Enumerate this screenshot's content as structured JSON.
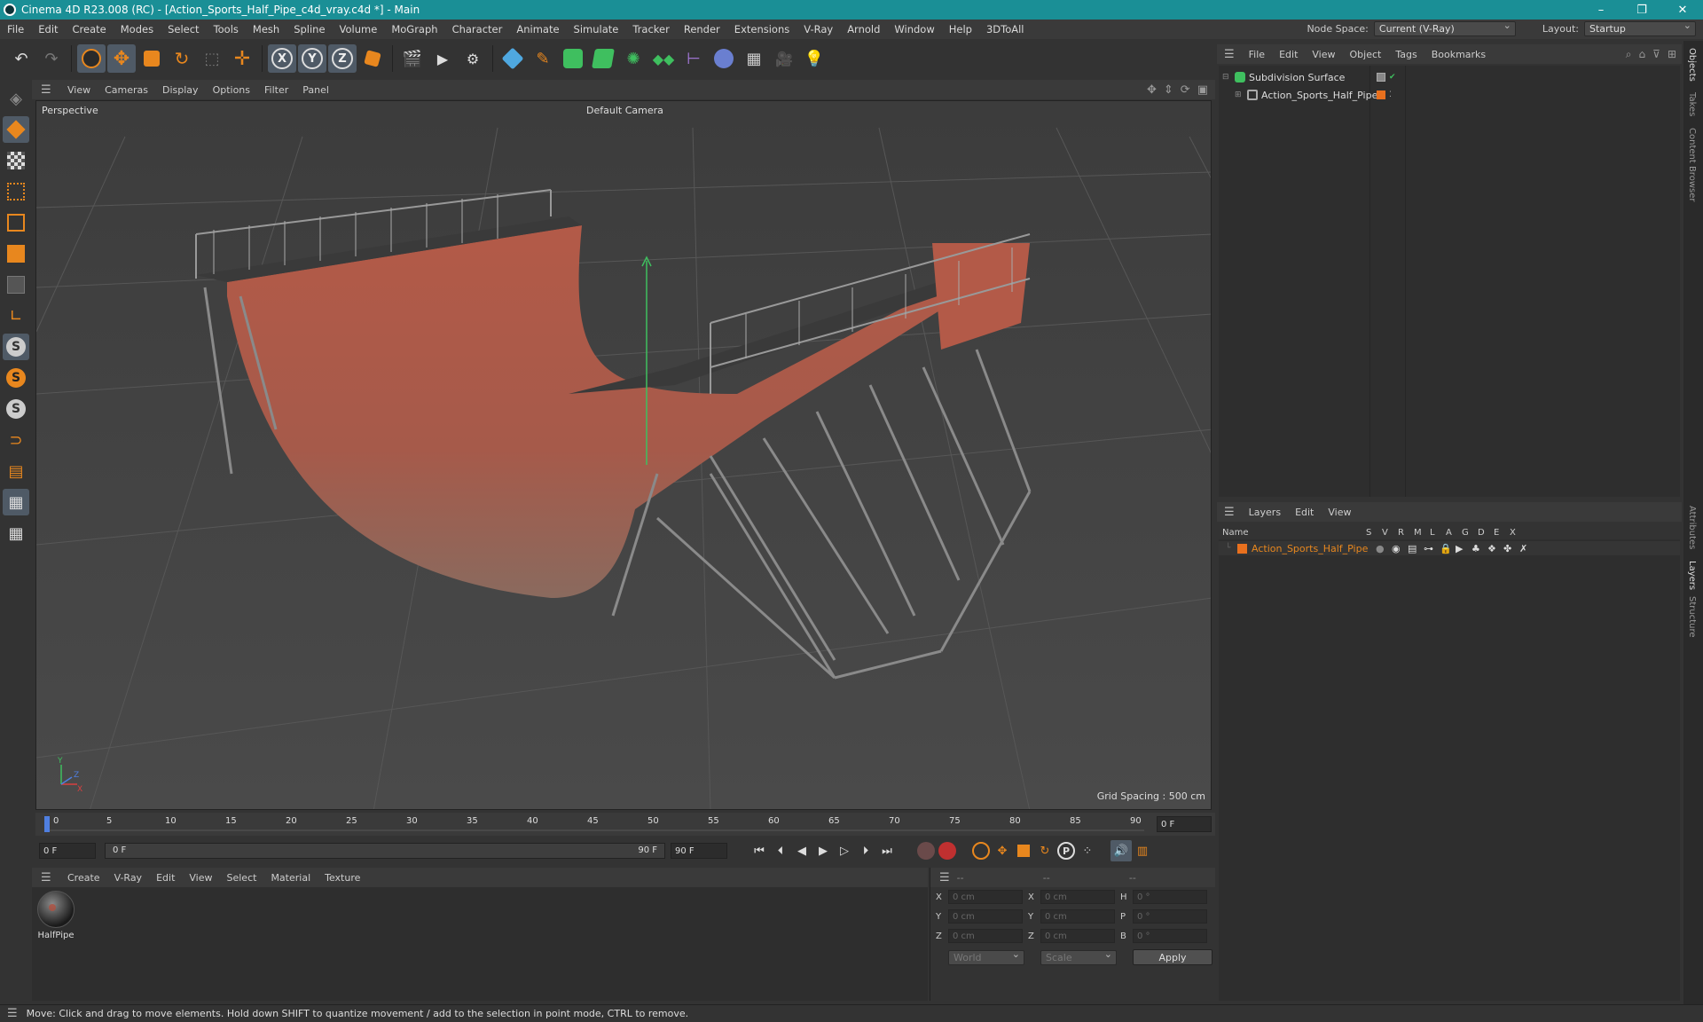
{
  "window": {
    "title": "Cinema 4D R23.008 (RC) - [Action_Sports_Half_Pipe_c4d_vray.c4d *] - Main",
    "controls": [
      "–",
      "❐",
      "✕"
    ]
  },
  "menu": {
    "items": [
      "File",
      "Edit",
      "Create",
      "Modes",
      "Select",
      "Tools",
      "Mesh",
      "Spline",
      "Volume",
      "MoGraph",
      "Character",
      "Animate",
      "Simulate",
      "Tracker",
      "Render",
      "Extensions",
      "V-Ray",
      "Arnold",
      "Window",
      "Help",
      "3DToAll"
    ],
    "node_space_label": "Node Space:",
    "node_space_value": "Current (V-Ray)",
    "layout_label": "Layout:",
    "layout_value": "Startup"
  },
  "toolbar": {
    "axes": [
      "X",
      "Y",
      "Z"
    ]
  },
  "viewport": {
    "menu": [
      "View",
      "Cameras",
      "Display",
      "Options",
      "Filter",
      "Panel"
    ],
    "name": "Perspective",
    "camera": "Default Camera",
    "grid_spacing": "Grid Spacing : 500 cm"
  },
  "timeline": {
    "ticks": [
      "0",
      "5",
      "10",
      "15",
      "20",
      "25",
      "30",
      "35",
      "40",
      "45",
      "50",
      "55",
      "60",
      "65",
      "70",
      "75",
      "80",
      "85",
      "90"
    ],
    "current_frame": "0 F"
  },
  "playbar": {
    "start_frame": "0 F",
    "range_start": "0 F",
    "range_end": "90 F",
    "end_frame": "90 F"
  },
  "material_manager": {
    "menu": [
      "Create",
      "V-Ray",
      "Edit",
      "View",
      "Select",
      "Material",
      "Texture"
    ],
    "materials": [
      {
        "name": "HalfPipe"
      }
    ]
  },
  "coordinates": {
    "headers": [
      "--",
      "--",
      "--"
    ],
    "rows": [
      {
        "a1": "X",
        "v1": "0 cm",
        "a2": "X",
        "v2": "0 cm",
        "a3": "H",
        "v3": "0 °"
      },
      {
        "a1": "Y",
        "v1": "0 cm",
        "a2": "Y",
        "v2": "0 cm",
        "a3": "P",
        "v3": "0 °"
      },
      {
        "a1": "Z",
        "v1": "0 cm",
        "a2": "Z",
        "v2": "0 cm",
        "a3": "B",
        "v3": "0 °"
      }
    ],
    "coord_system": "World",
    "mode": "Scale",
    "apply_label": "Apply"
  },
  "object_manager": {
    "menu": [
      "File",
      "Edit",
      "View",
      "Object",
      "Tags",
      "Bookmarks"
    ],
    "objects": [
      {
        "name": "Subdivision Surface"
      },
      {
        "name": "Action_Sports_Half_Pipe"
      }
    ]
  },
  "layer_manager": {
    "menu": [
      "Layers",
      "Edit",
      "View"
    ],
    "columns": [
      "Name",
      "S",
      "V",
      "R",
      "M",
      "L",
      "A",
      "G",
      "D",
      "E",
      "X"
    ],
    "layers": [
      {
        "name": "Action_Sports_Half_Pipe",
        "color": "#e8701e"
      }
    ]
  },
  "side_tabs": [
    "Objects",
    "Takes",
    "Content Browser",
    "Attributes",
    "Layers",
    "Structure"
  ],
  "status": {
    "message": "Move: Click and drag to move elements. Hold down SHIFT to quantize movement / add to the selection in point mode, CTRL to remove."
  },
  "colors": {
    "titlebar": "#1a8f96",
    "accent_orange": "#e8871e",
    "ramp": "#b8604c",
    "axis_y": "#3fbf5f"
  }
}
